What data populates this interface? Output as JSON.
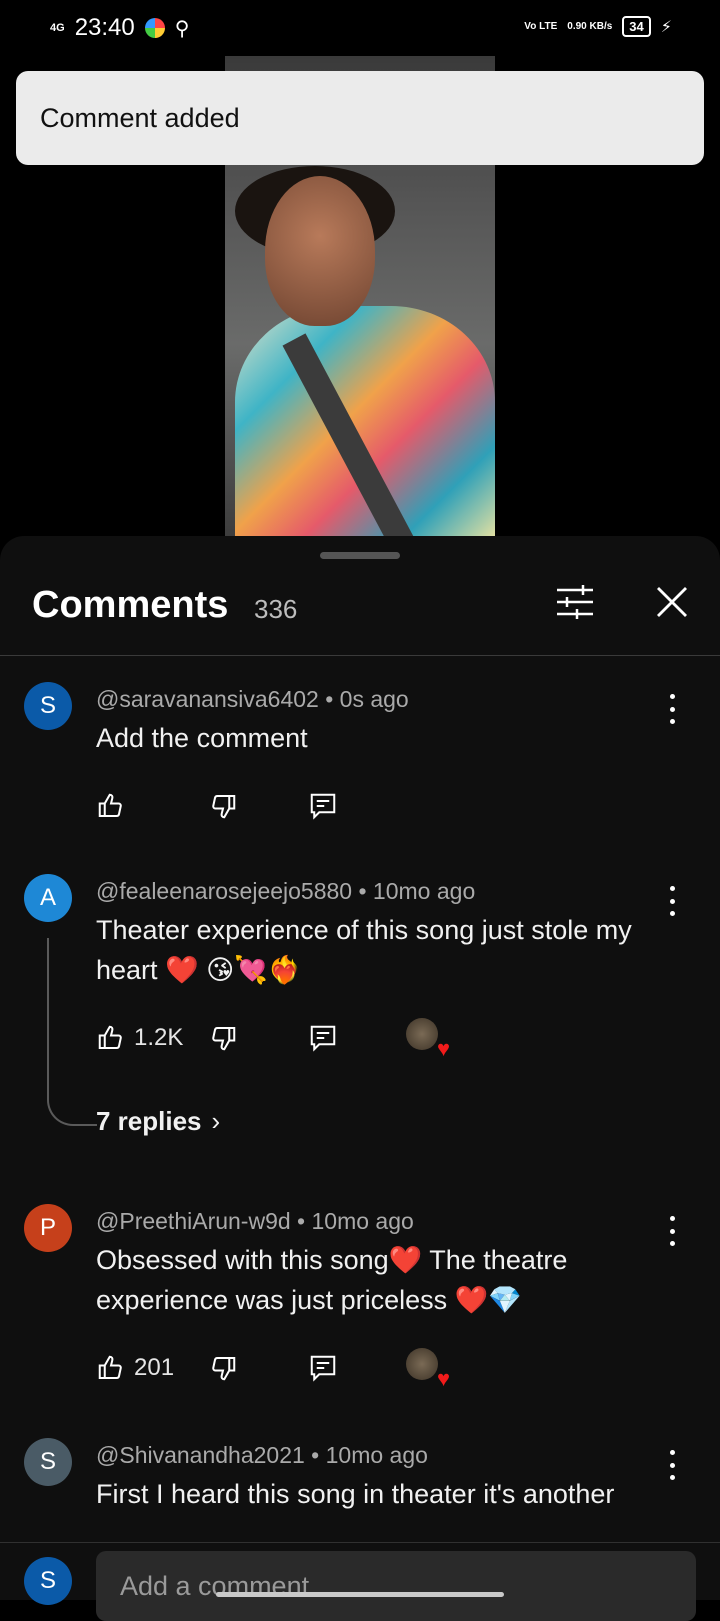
{
  "status_bar": {
    "time": "23:40",
    "network": "4G",
    "volte": "Vo LTE",
    "speed": "0.90 KB/s",
    "battery": "34"
  },
  "toast": {
    "text": "Comment added"
  },
  "comments_header": {
    "title": "Comments",
    "count": "336"
  },
  "comments": [
    {
      "avatar_letter": "S",
      "avatar_color": "#0b5aa8",
      "meta": "@saravanansiva6402 • 0s ago",
      "text": "Add the comment",
      "likes": ""
    },
    {
      "avatar_letter": "A",
      "avatar_color": "#1e88d6",
      "meta": "@fealeenarosejeejo5880 • 10mo ago",
      "text": "Theater experience of this song just stole my heart ❤️ 😘💘❤️‍🔥",
      "likes": "1.2K",
      "replies": "7 replies"
    },
    {
      "avatar_letter": "P",
      "avatar_color": "#c6401b",
      "meta": "@PreethiArun-w9d • 10mo ago",
      "text": "Obsessed with this song❤️ The theatre experience was just priceless ❤️💎",
      "likes": "201"
    },
    {
      "avatar_letter": "S",
      "avatar_color": "#4a5b66",
      "meta": "@Shivanandha2021 • 10mo ago",
      "text": "First I heard this song in theater it's another"
    }
  ],
  "composer": {
    "avatar_letter": "S",
    "placeholder": "Add a comment..."
  }
}
